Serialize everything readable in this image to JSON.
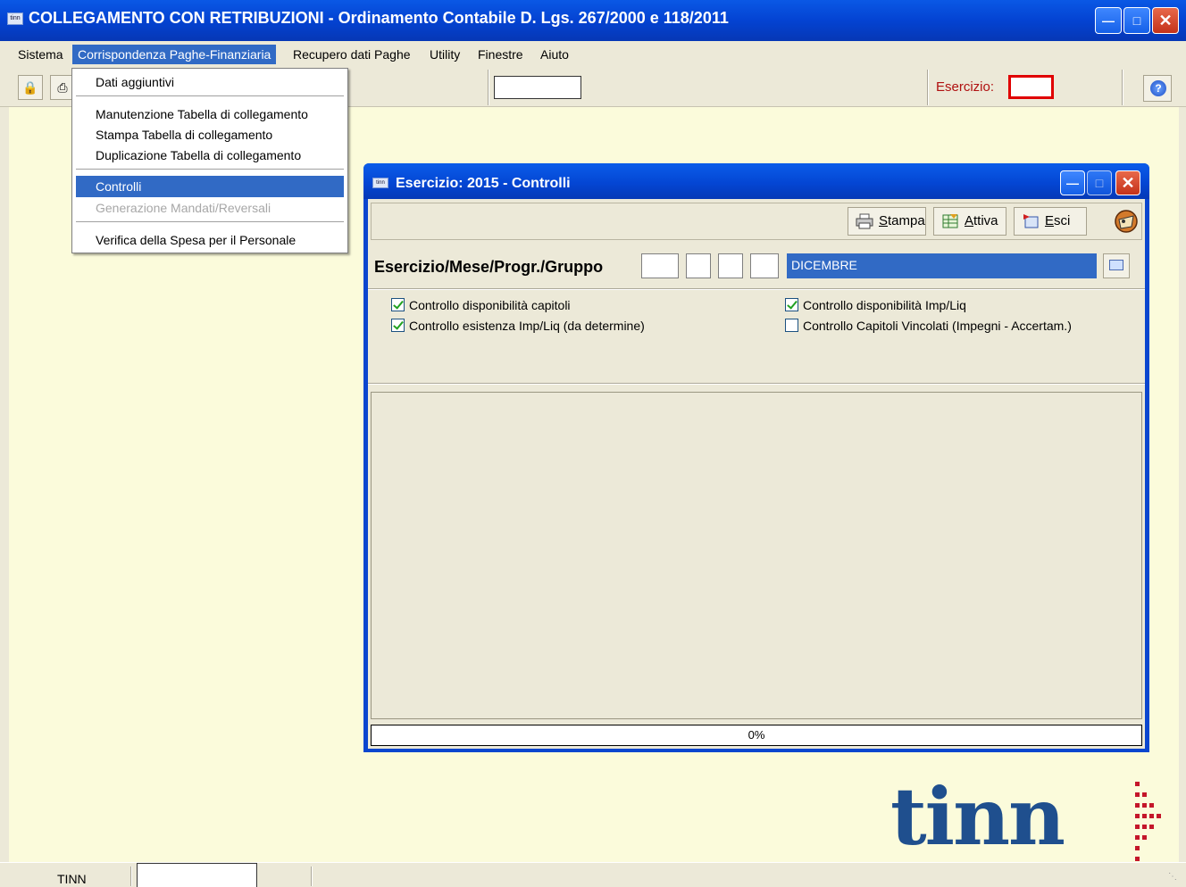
{
  "app": {
    "title": "COLLEGAMENTO CON RETRIBUZIONI - Ordinamento Contabile D. Lgs. 267/2000 e 118/2011",
    "icon_text": "tinn"
  },
  "menubar": {
    "items": [
      {
        "label": "Sistema"
      },
      {
        "label": "Corrispondenza Paghe-Finanziaria"
      },
      {
        "label": "Recupero dati Paghe"
      },
      {
        "label": "Utility"
      },
      {
        "label": "Finestre"
      },
      {
        "label": "Aiuto"
      }
    ]
  },
  "toolbar": {
    "esercizio_label": "Esercizio:",
    "esercizio_value": "",
    "help_icon": "help-icon"
  },
  "dropdown": {
    "items": [
      {
        "label": "Dati aggiuntivi"
      },
      {
        "label": "Manutenzione Tabella di collegamento"
      },
      {
        "label": "Stampa Tabella di collegamento"
      },
      {
        "label": "Duplicazione Tabella di collegamento"
      },
      {
        "label": "Controlli"
      },
      {
        "label": "Generazione Mandati/Reversali"
      },
      {
        "label": "Verifica della Spesa per il Personale"
      }
    ]
  },
  "child": {
    "title": "Esercizio: 2015 - Controlli",
    "icon_text": "tinn",
    "buttons": {
      "stampa_underline": "S",
      "stampa_rest": "tampa",
      "attiva_underline": "A",
      "attiva_rest": "ttiva",
      "esci_underline": "E",
      "esci_rest": "sci"
    },
    "param_label": "Esercizio/Mese/Progr./Gruppo",
    "month": "DICEMBRE",
    "checks": {
      "c1": {
        "label": "Controllo disponibilità capitoli",
        "checked": true
      },
      "c2": {
        "label": "Controllo esistenza Imp/Liq (da determine)",
        "checked": true
      },
      "c3": {
        "label": "Controllo disponibilità Imp/Liq",
        "checked": true
      },
      "c4": {
        "label": "Controllo Capitoli Vincolati (Impegni - Accertam.)",
        "checked": false
      }
    },
    "progress": {
      "value": 0,
      "label": "0%"
    }
  },
  "logo": {
    "text": "tinn"
  },
  "statusbar": {
    "text": "TINN"
  },
  "colors": {
    "titlebar": "#0443d2",
    "selection": "#316ac5",
    "mdi_background": "#fbfbdb",
    "esercizio_red": "#e00000",
    "logo_blue": "#1f4f8e",
    "logo_red": "#c4162a"
  }
}
